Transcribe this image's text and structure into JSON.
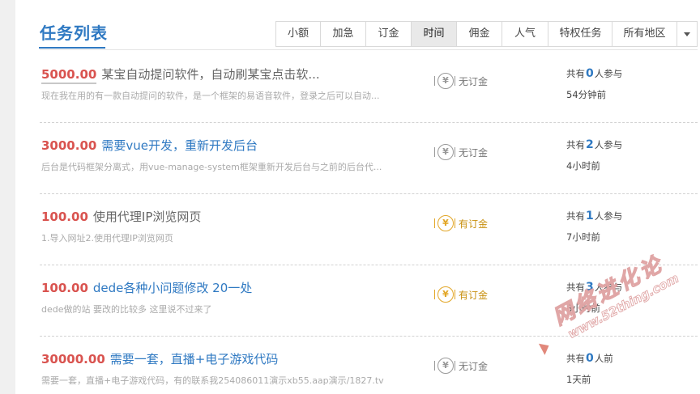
{
  "header": {
    "title": "任务列表",
    "filters": [
      {
        "label": "小额",
        "active": false
      },
      {
        "label": "加急",
        "active": false
      },
      {
        "label": "订金",
        "active": false
      },
      {
        "label": "时间",
        "active": true
      },
      {
        "label": "佣金",
        "active": false
      },
      {
        "label": "人气",
        "active": false
      },
      {
        "label": "特权任务",
        "active": false
      }
    ],
    "region": "所有地区"
  },
  "tasks": [
    {
      "price": "5000.00",
      "title": "某宝自动提问软件，自动刷某宝点击软...",
      "desc": "现在我在用的有一款自动提问的软件，是一个框架的易语音软件，登录之后可以自动...",
      "deposit": "无订金",
      "participants_prefix": "共有",
      "participants_count": "0",
      "participants_suffix": "人参与",
      "time": "54分钟前"
    },
    {
      "price": "3000.00",
      "title": "需要vue开发，重新开发后台",
      "desc": "后台是代码框架分离式，用vue-manage-system框架重新开发后台与之前的后台代...",
      "deposit": "无订金",
      "participants_prefix": "共有",
      "participants_count": "2",
      "participants_suffix": "人参与",
      "time": "4小时前"
    },
    {
      "price": "100.00",
      "title": "使用代理IP浏览网页",
      "desc": "1.导入网址2.使用代理IP浏览网页",
      "deposit": "有订金",
      "participants_prefix": "共有",
      "participants_count": "1",
      "participants_suffix": "人参与",
      "time": "7小时前"
    },
    {
      "price": "100.00",
      "title": "dede各种小问题修改 20一处",
      "desc": "dede做的站 要改的比较多 这里说不过来了",
      "deposit": "有订金",
      "participants_prefix": "共有",
      "participants_count": "3",
      "participants_suffix": "人参与",
      "time": "8小时前"
    },
    {
      "price": "30000.00",
      "title": "需要一套，直播+电子游戏代码",
      "desc": "需要一套，直播+电子游戏代码，有的联系我254086011演示xb55.aap演示/1827.tv",
      "deposit": "无订金",
      "participants_prefix": "共有",
      "participants_count": "0",
      "participants_suffix": "人前",
      "time": "1天前"
    }
  ],
  "watermark": {
    "line1": "网络进化论",
    "line2": "www.52thing.com"
  },
  "colors": {
    "accent": "#2f79c2",
    "price": "#d9534f",
    "deposit_has": "#e2a626",
    "deposit_none": "#999999"
  }
}
